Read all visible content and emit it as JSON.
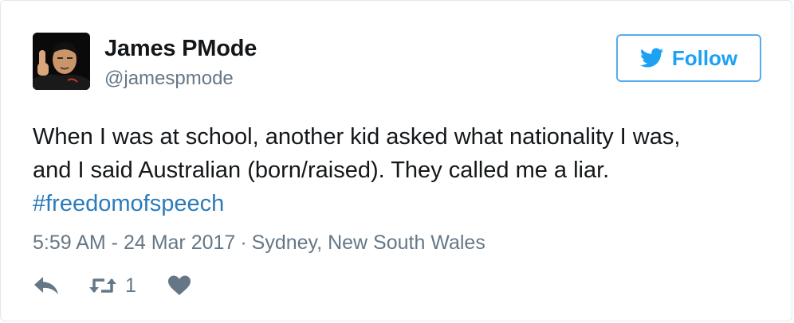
{
  "user": {
    "display_name": "James PMode",
    "handle": "@jamespmode"
  },
  "follow_button": {
    "label": "Follow"
  },
  "tweet": {
    "text_line1": "When I was at school, another kid asked what nationality I was,",
    "text_line2": "and I said Australian (born/raised). They called me a liar.",
    "hashtag": "#freedomofspeech",
    "timestamp": "5:59 AM - 24 Mar 2017",
    "separator": "·",
    "location": "Sydney, New South Wales"
  },
  "actions": {
    "reply_icon": "reply-icon",
    "retweet_icon": "retweet-icon",
    "retweet_count": "1",
    "like_icon": "heart-icon"
  },
  "colors": {
    "accent": "#1da1f2",
    "hashtag": "#2b7bb9",
    "muted": "#657786",
    "text": "#14171a"
  }
}
